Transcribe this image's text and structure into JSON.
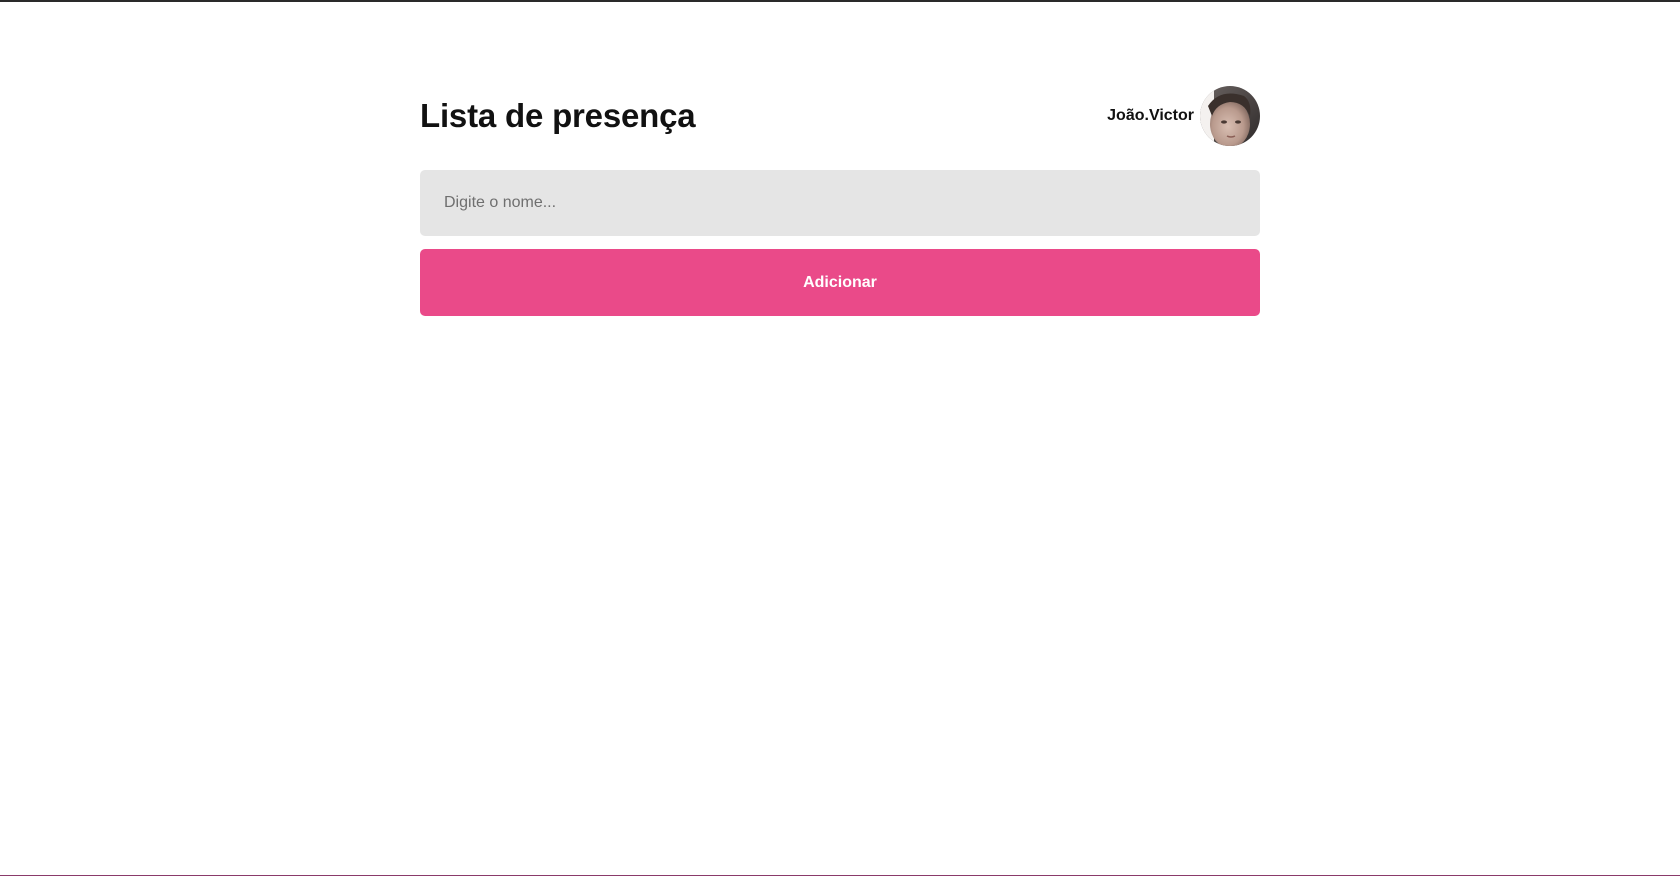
{
  "header": {
    "title": "Lista de presença",
    "user": {
      "name": "João.Victor",
      "avatar": "user-photo"
    }
  },
  "form": {
    "input": {
      "value": "",
      "placeholder": "Digite o nome..."
    },
    "button_label": "Adicionar"
  },
  "colors": {
    "accent": "#ea4a89",
    "input_background": "#e5e5e5",
    "text": "#111111"
  }
}
